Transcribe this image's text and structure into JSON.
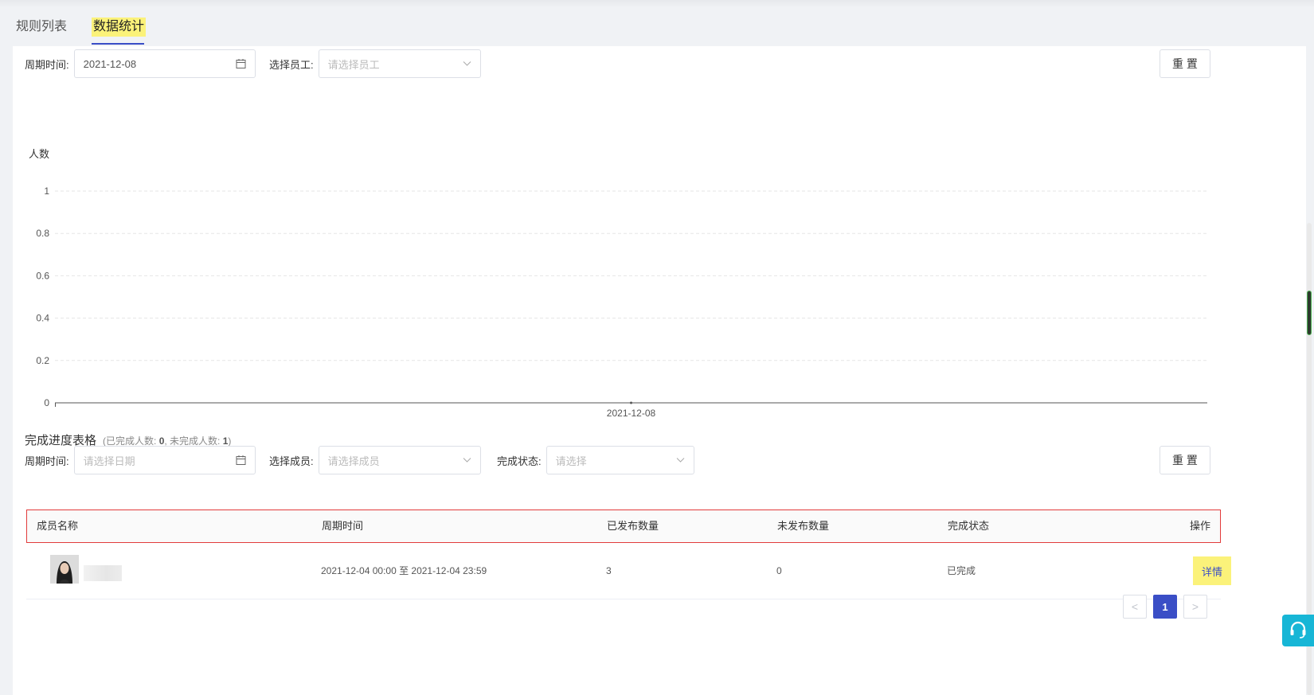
{
  "tabs": [
    {
      "label": "规则列表",
      "active": false
    },
    {
      "label": "数据统计",
      "active": true
    }
  ],
  "filters_top": {
    "period_label": "周期时间:",
    "period_value": "2021-12-08",
    "employee_label": "选择员工:",
    "employee_placeholder": "请选择员工",
    "reset_label": "重 置"
  },
  "chart_data": {
    "type": "line",
    "ylabel": "人数",
    "xlabel": "",
    "categories": [
      "2021-12-08"
    ],
    "series": [
      {
        "values": [
          0
        ]
      }
    ],
    "ylim": [
      0,
      1
    ],
    "yticks": [
      "0",
      "0.2",
      "0.4",
      "0.6",
      "0.8",
      "1"
    ],
    "grid": true
  },
  "progress": {
    "title": "完成进度表格",
    "summary_prefix": "(已完成人数: ",
    "done_count": "0",
    "summary_mid": ", 未完成人数: ",
    "undone_count": "1",
    "summary_suffix": ")"
  },
  "filters_bottom": {
    "period_label": "周期时间:",
    "period_placeholder": "请选择日期",
    "member_label": "选择成员:",
    "member_placeholder": "请选择成员",
    "status_label": "完成状态:",
    "status_placeholder": "请选择",
    "reset_label": "重 置"
  },
  "table": {
    "columns": [
      "成员名称",
      "周期时间",
      "已发布数量",
      "未发布数量",
      "完成状态",
      "操作"
    ],
    "rows": [
      {
        "period": "2021-12-04 00:00 至 2021-12-04 23:59",
        "published": "3",
        "unpublished": "0",
        "status": "已完成",
        "action": "详情"
      }
    ]
  },
  "pagination": {
    "prev": "<",
    "current": "1",
    "next": ">"
  },
  "colors": {
    "accent": "#3a4ec6",
    "highlight": "#fbf27a",
    "help": "#17b6d6",
    "border_alert": "#e23b3b"
  }
}
